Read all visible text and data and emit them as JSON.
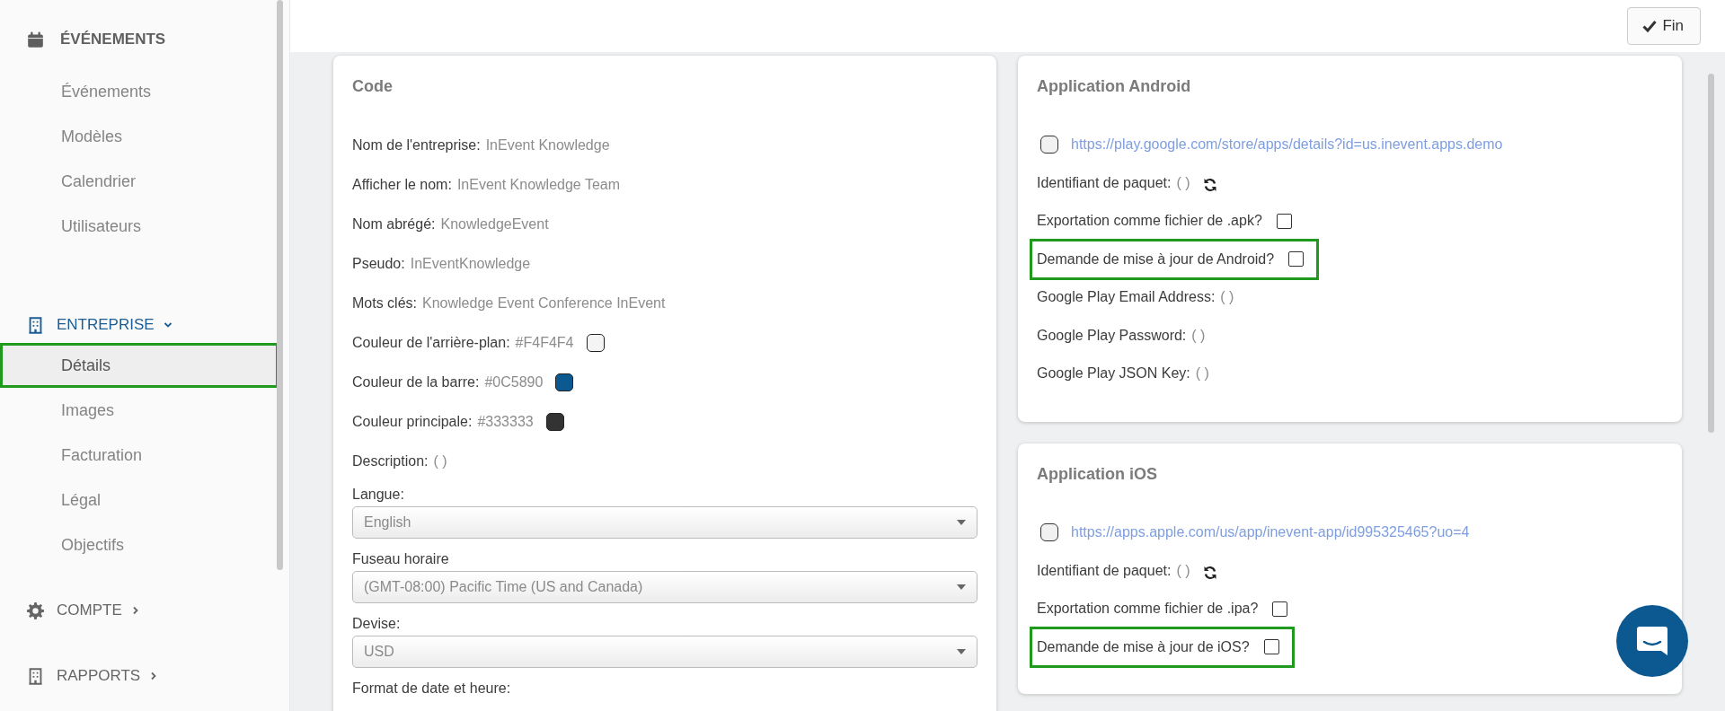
{
  "sidebar": {
    "sections": [
      {
        "kind": "title",
        "label": "ÉVÉNEMENTS",
        "items": [
          {
            "label": "Événements",
            "selected": false,
            "highlighted": false
          },
          {
            "label": "Modèles",
            "selected": false,
            "highlighted": false
          },
          {
            "label": "Calendrier",
            "selected": false,
            "highlighted": false
          },
          {
            "label": "Utilisateurs",
            "selected": false,
            "highlighted": false
          }
        ]
      },
      {
        "kind": "group",
        "label": "ENTREPRISE",
        "active": true,
        "expanded": true,
        "items": [
          {
            "label": "Détails",
            "selected": true,
            "highlighted": true
          },
          {
            "label": "Images",
            "selected": false,
            "highlighted": false
          },
          {
            "label": "Facturation",
            "selected": false,
            "highlighted": false
          },
          {
            "label": "Légal",
            "selected": false,
            "highlighted": false
          },
          {
            "label": "Objectifs",
            "selected": false,
            "highlighted": false
          }
        ]
      },
      {
        "kind": "group",
        "label": "COMPTE",
        "active": false,
        "expanded": false
      },
      {
        "kind": "group",
        "label": "RAPPORTS",
        "active": false,
        "expanded": false
      }
    ]
  },
  "toolbar": {
    "done_button": "Fin"
  },
  "company_card": {
    "title": "Code",
    "fields": [
      {
        "kind": "text",
        "label": "Nom de l'entreprise:",
        "value": "InEvent Knowledge"
      },
      {
        "kind": "text",
        "label": "Afficher le nom:",
        "value": "InEvent Knowledge Team"
      },
      {
        "kind": "text",
        "label": "Nom abrégé:",
        "value": "KnowledgeEvent"
      },
      {
        "kind": "text",
        "label": "Pseudo:",
        "value": "InEventKnowledge"
      },
      {
        "kind": "text",
        "label": "Mots clés:",
        "value": "Knowledge Event Conference InEvent"
      },
      {
        "kind": "color",
        "label": "Couleur de l'arrière-plan:",
        "value": "#F4F4F4",
        "color": "#f4f4f4"
      },
      {
        "kind": "color",
        "label": "Couleur de la barre:",
        "value": "#0C5890",
        "color": "#0c5890"
      },
      {
        "kind": "color",
        "label": "Couleur principale:",
        "value": "#333333",
        "color": "#333333"
      },
      {
        "kind": "text",
        "label": "Description:",
        "value": "( )"
      },
      {
        "kind": "select",
        "label": "Langue:",
        "value": "English"
      },
      {
        "kind": "select",
        "label": "Fuseau horaire",
        "value": "(GMT-08:00) Pacific Time (US and Canada)"
      },
      {
        "kind": "select",
        "label": "Devise:",
        "value": "USD"
      },
      {
        "kind": "label",
        "label": "Format de date et heure:"
      }
    ]
  },
  "apps": [
    {
      "title": "Application Android",
      "rows": [
        {
          "kind": "link",
          "url": "https://play.google.com/store/apps/details?id=us.inevent.apps.demo",
          "checked": false
        },
        {
          "kind": "refresh",
          "label": "Identifiant de paquet:",
          "value": "( )"
        },
        {
          "kind": "checkbox",
          "label": "Exportation comme fichier de .apk?",
          "checked": false,
          "highlighted": false
        },
        {
          "kind": "checkbox",
          "label": "Demande de mise à jour de Android?",
          "checked": false,
          "highlighted": true
        },
        {
          "kind": "text",
          "label": "Google Play Email Address:",
          "value": "( )"
        },
        {
          "kind": "text",
          "label": "Google Play Password:",
          "value": "( )"
        },
        {
          "kind": "text",
          "label": "Google Play JSON Key:",
          "value": "( )"
        }
      ]
    },
    {
      "title": "Application iOS",
      "rows": [
        {
          "kind": "link",
          "url": "https://apps.apple.com/us/app/inevent-app/id995325465?uo=4",
          "checked": false
        },
        {
          "kind": "refresh",
          "label": "Identifiant de paquet:",
          "value": "( )"
        },
        {
          "kind": "checkbox",
          "label": "Exportation comme fichier de .ipa?",
          "checked": false,
          "highlighted": false
        },
        {
          "kind": "checkbox",
          "label": "Demande de mise à jour de iOS?",
          "checked": false,
          "highlighted": true
        }
      ]
    }
  ]
}
